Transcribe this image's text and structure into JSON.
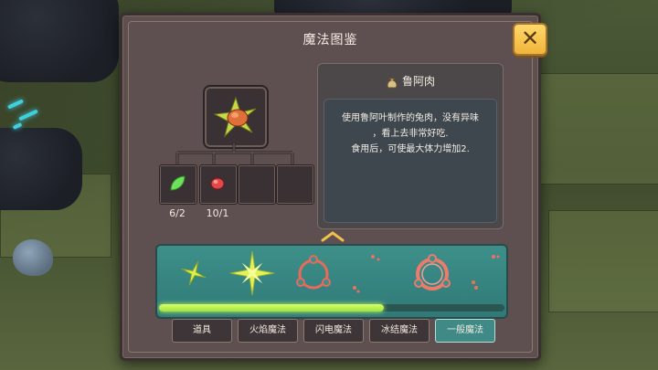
{
  "window": {
    "title": "魔法图鉴",
    "close_label": "✕"
  },
  "item": {
    "name": "鲁阿肉",
    "icon": "meat-bag-icon",
    "description_lines": [
      "使用鲁阿叶制作的兔肉，没有异味",
      "，看上去非常好吃.",
      "食用后，可使最大体力增加2."
    ]
  },
  "recipe": {
    "result_icon": "luah-leaf-meat-icon",
    "ingredients": [
      {
        "icon": "green-leaf-icon",
        "count": "6/2"
      },
      {
        "icon": "red-meat-icon",
        "count": "10/1"
      },
      {
        "icon": "",
        "count": ""
      },
      {
        "icon": "",
        "count": ""
      }
    ]
  },
  "spell_strip": {
    "spells": [
      "green-star-spell",
      "green-star-spell-large",
      "red-ring-spell",
      "red-ring-spell-burst"
    ],
    "progress": 0.65
  },
  "tabs": [
    {
      "label": "道具",
      "active": false
    },
    {
      "label": "火焰魔法",
      "active": false
    },
    {
      "label": "闪电魔法",
      "active": false
    },
    {
      "label": "冰结魔法",
      "active": false
    },
    {
      "label": "一般魔法",
      "active": true
    }
  ],
  "colors": {
    "accent": "#f0b43a",
    "panel": "#5e4f51",
    "strip": "#3e8f8a",
    "progress": "#c6ff63"
  }
}
